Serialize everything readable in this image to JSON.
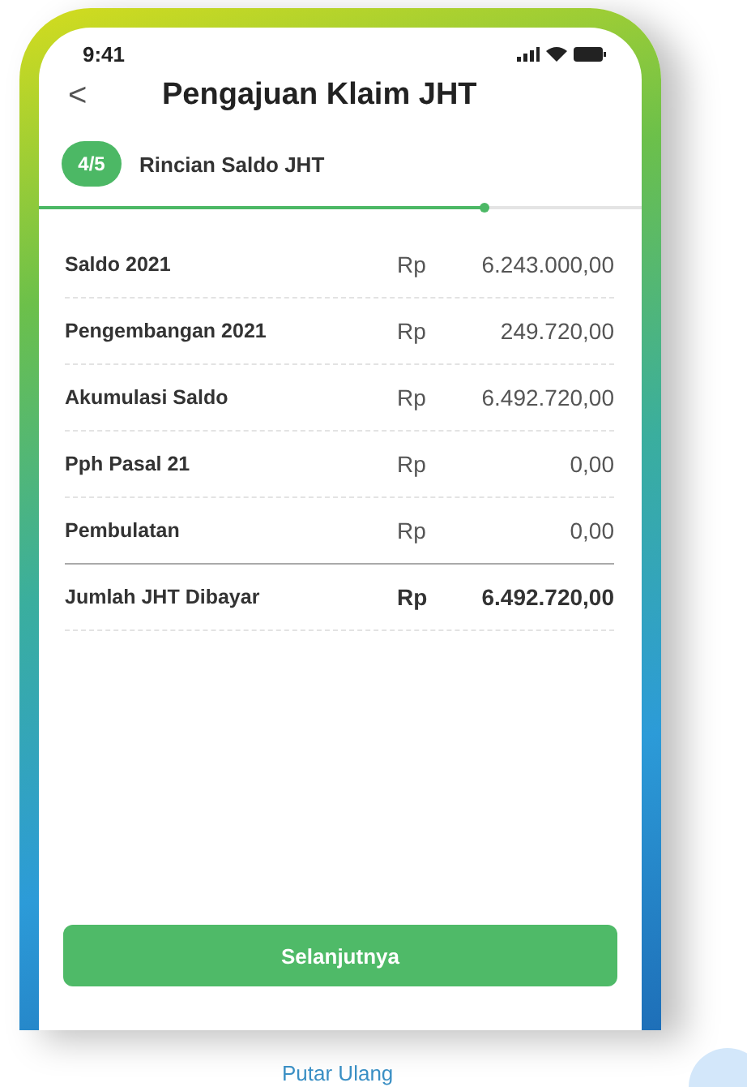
{
  "status_bar": {
    "time": "9:41"
  },
  "header": {
    "back": "<",
    "title": "Pengajuan Klaim JHT"
  },
  "step": {
    "badge": "4/5",
    "title": "Rincian Saldo JHT",
    "level": 0.74
  },
  "rows": [
    {
      "kind": "item",
      "label": "Saldo 2021",
      "currency": "Rp",
      "amount": "6.243.000,00"
    },
    {
      "kind": "item",
      "label": "Pengembangan 2021",
      "currency": "Rp",
      "amount": "249.720,00"
    },
    {
      "kind": "item",
      "label": "Akumulasi Saldo",
      "currency": "Rp",
      "amount": "6.492.720,00"
    },
    {
      "kind": "item",
      "label": "Pph Pasal 21",
      "currency": "Rp",
      "amount": "0,00"
    },
    {
      "kind": "item",
      "label": "Pembulatan",
      "currency": "Rp",
      "amount": "0,00"
    },
    {
      "kind": "total",
      "label": "Jumlah JHT Dibayar",
      "currency": "Rp",
      "amount": "6.492.720,00"
    }
  ],
  "primary_button": "Selanjutnya",
  "replay_link": "Putar Ulang"
}
